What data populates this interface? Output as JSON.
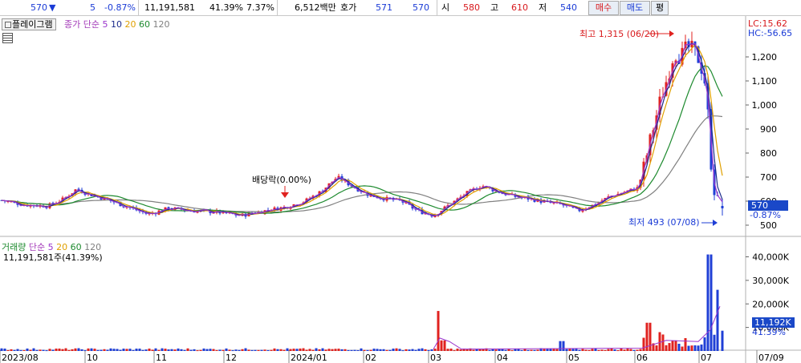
{
  "quote_bar": {
    "price": "570",
    "change_arrow": "▼",
    "change": "5",
    "change_pct": "-0.87%",
    "volume": "11,191,581",
    "volume_ratio": "41.39%",
    "turnover": "7.37%",
    "trade_value": "6,512백만",
    "hoga_label": "호가",
    "hoga_ask": "571",
    "hoga_bid": "570",
    "open_label": "시",
    "open": "580",
    "high_label": "고",
    "high": "610",
    "low_label": "저",
    "low": "540",
    "buy_button": "매수",
    "sell_button": "매도",
    "eval_button": "평"
  },
  "price_panel": {
    "tool_label": "플레이그램",
    "ma_title": "종가 단순",
    "ma_periods": [
      "5",
      "10",
      "20",
      "60",
      "120"
    ],
    "lc": "LC:15.62",
    "hc": "HC:-56.65",
    "high_note": "최고 1,315 (06/20)",
    "low_note": "최저 493 (07/08)",
    "dividend_note": "배당락(0.00%)",
    "current_price_tag": "570",
    "current_change_tag": "-0.87%",
    "y_ticks": [
      "1,200",
      "1,100",
      "1,000",
      "900",
      "800",
      "700",
      "600",
      "500"
    ]
  },
  "volume_panel": {
    "title": "거래량",
    "ma_title": "단순",
    "ma_periods": [
      "5",
      "20",
      "60",
      "120"
    ],
    "current_volume": "11,191,581주(41.39%)",
    "volume_tag": "11,192K",
    "ratio_tag": "41.39%",
    "y_ticks": [
      "40,000K",
      "30,000K",
      "20,000K",
      "10,000K"
    ]
  },
  "x_axis": [
    "2023/08",
    "10",
    "11",
    "12",
    "2024/01",
    "02",
    "03",
    "04",
    "05",
    "06",
    "07",
    "07/09"
  ],
  "colors": {
    "up": "#e0221f",
    "down": "#1f3fd6",
    "ma5": "#9a33cc",
    "ma10": "#1a2a8c",
    "ma20": "#e0a000",
    "ma60": "#1d8a2e",
    "ma120": "#808080",
    "tag_bg": "#1a48c8"
  },
  "chart_data": {
    "type": "candlestick",
    "price_range": [
      480,
      1320
    ],
    "high_point": {
      "value": 1315,
      "date": "06/20"
    },
    "low_point": {
      "value": 493,
      "date": "07/08"
    },
    "last": {
      "open": 580,
      "high": 610,
      "low": 540,
      "close": 570
    },
    "volume_range_k": [
      0,
      45000
    ],
    "last_volume": 11191581
  }
}
